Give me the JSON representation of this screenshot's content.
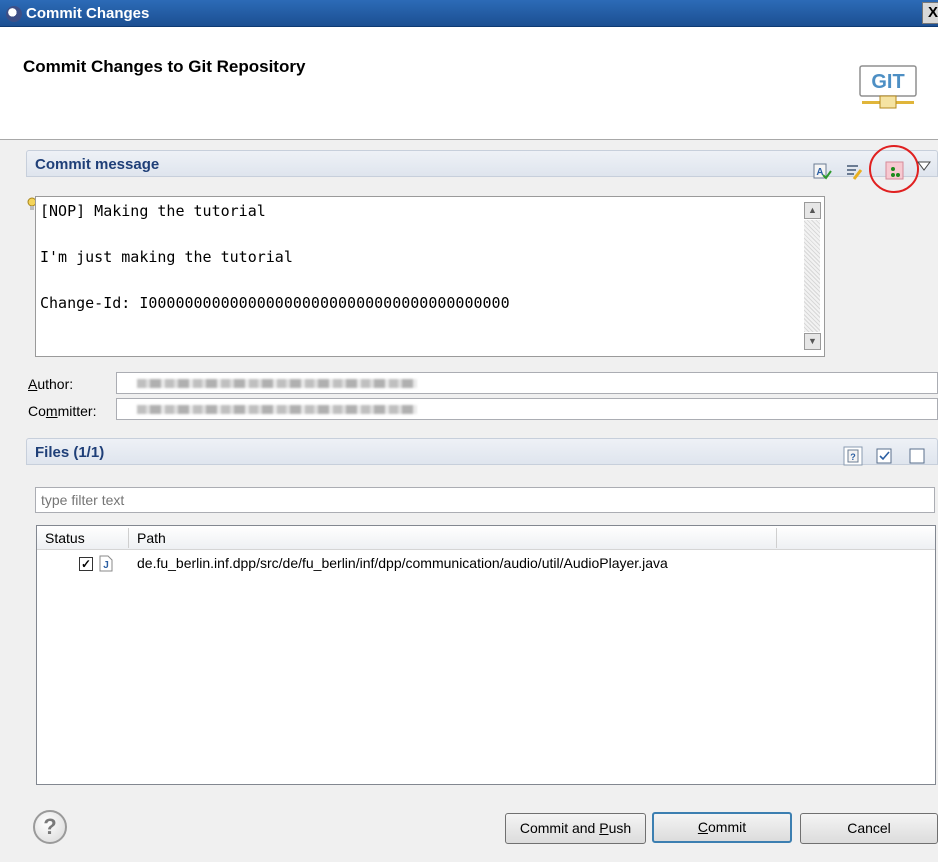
{
  "window": {
    "title": "Commit Changes"
  },
  "header": {
    "title": "Commit Changes to Git Repository",
    "logo_text": "GIT"
  },
  "commit_message": {
    "section_label": "Commit message",
    "lines": [
      "[NOP] Making the tutorial",
      "",
      "I'm just making the tutorial",
      "",
      "Change-Id: I0000000000000000000000000000000000000000"
    ],
    "toolbar_icons": [
      "spell-check-icon",
      "format-icon",
      "add-change-id-icon",
      "dropdown-arrow-icon"
    ]
  },
  "author": {
    "label": "Author:",
    "value": ""
  },
  "committer": {
    "label": "Committer:",
    "value": ""
  },
  "files": {
    "section_label": "Files (1/1)",
    "filter_placeholder": "type filter text",
    "columns": [
      "Status",
      "Path"
    ],
    "rows": [
      {
        "checked": true,
        "type_icon": "java-file-icon",
        "path": "de.fu_berlin.inf.dpp/src/de/fu_berlin/inf/dpp/communication/audio/util/AudioPlayer.java"
      }
    ]
  },
  "buttons": {
    "commit_and_push": {
      "label_pre": "Commit and ",
      "label_u": "P",
      "label_post": "ush"
    },
    "commit": {
      "label_pre": "",
      "label_u": "C",
      "label_post": "ommit"
    },
    "cancel": {
      "label": "Cancel"
    }
  },
  "colors": {
    "accent": "#1f3f78",
    "highlight_circle": "#e02020"
  }
}
